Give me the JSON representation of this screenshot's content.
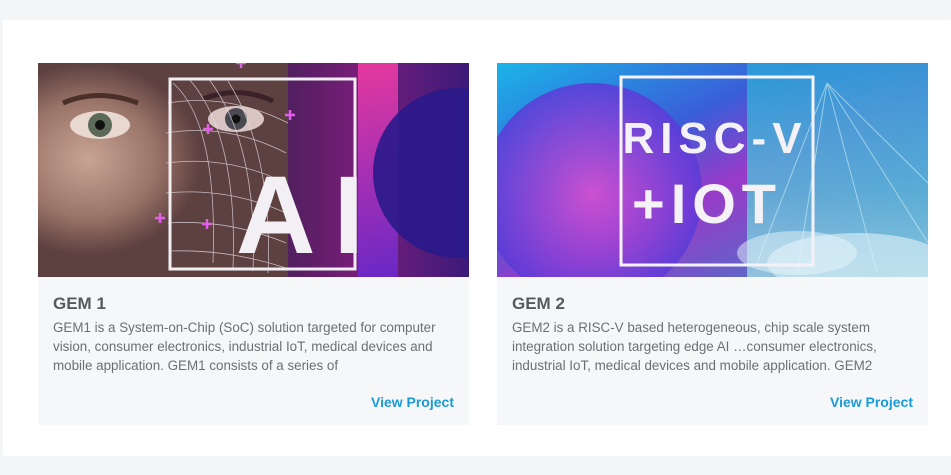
{
  "projects": [
    {
      "title": "GEM 1",
      "description": "GEM1 is a System-on-Chip (SoC) solution targeted for computer vision, consumer electronics, industrial IoT, medical devices and mobile application. GEM1 consists of a series of",
      "link_label": "View Project",
      "image_text": "AI"
    },
    {
      "title": "GEM 2",
      "description": "GEM2 is a RISC-V based heterogeneous, chip scale system integration solution targeting edge AI …consumer electronics, industrial IoT, medical devices and mobile application. GEM2",
      "link_label": "View Project",
      "image_text_line1": "RISC-V",
      "image_text_line2": "+IOT"
    }
  ],
  "colors": {
    "panel_background": "#ffffff",
    "page_background": "#f4f5f7",
    "card_background": "#f6f7f9",
    "title_color": "#555a60",
    "link_color": "#1a9ad6"
  }
}
